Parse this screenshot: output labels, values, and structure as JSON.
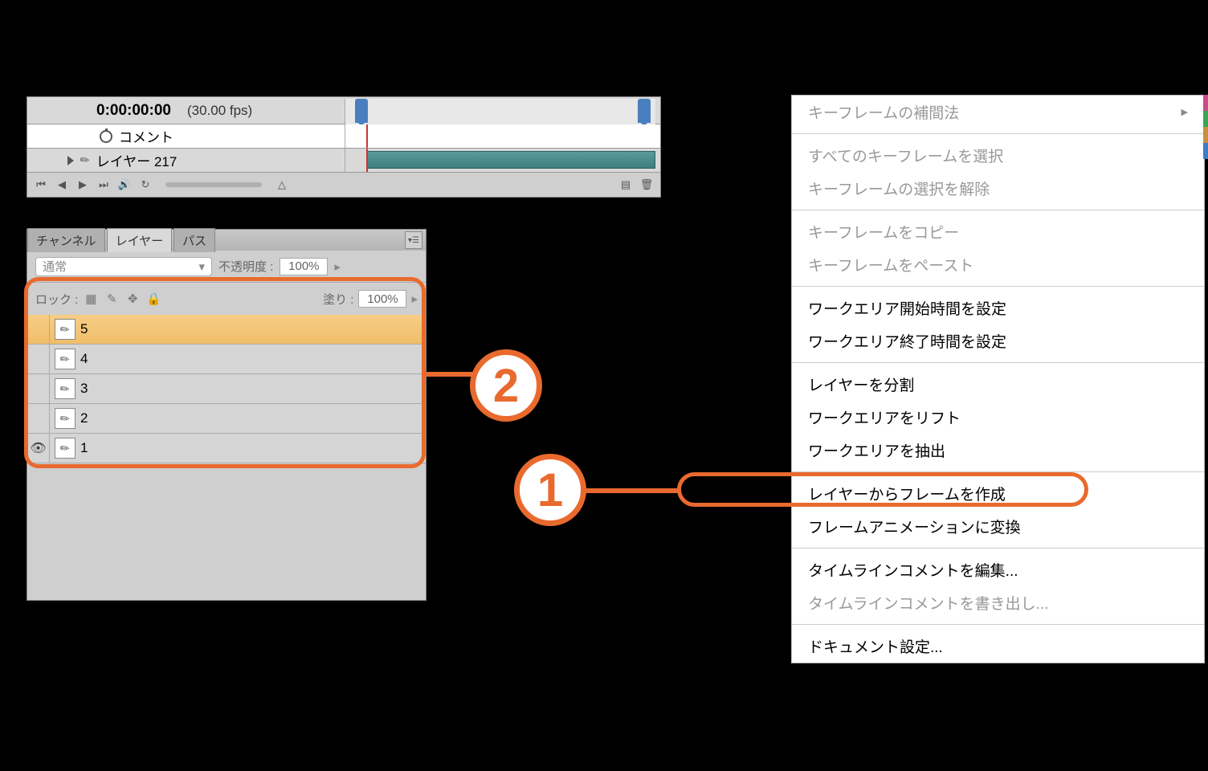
{
  "timeline": {
    "time": "0:00:00:00",
    "fps": "(30.00 fps)",
    "comment_label": "コメント",
    "layer_label": "レイヤー 217"
  },
  "layers_panel": {
    "tabs": [
      "チャンネル",
      "レイヤー",
      "パス"
    ],
    "blend_mode": "通常",
    "opacity_label": "不透明度 :",
    "opacity_value": "100%",
    "lock_label": "ロック :",
    "fill_label": "塗り :",
    "fill_value": "100%",
    "items": [
      {
        "name": "5",
        "visible": false,
        "selected": true
      },
      {
        "name": "4",
        "visible": false,
        "selected": false
      },
      {
        "name": "3",
        "visible": false,
        "selected": false
      },
      {
        "name": "2",
        "visible": false,
        "selected": false
      },
      {
        "name": "1",
        "visible": true,
        "selected": false
      }
    ]
  },
  "context_menu": {
    "items": [
      {
        "label": "キーフレームの補間法",
        "type": "submenu",
        "disabled": true
      },
      {
        "type": "sep"
      },
      {
        "label": "すべてのキーフレームを選択",
        "disabled": true
      },
      {
        "label": "キーフレームの選択を解除",
        "disabled": true
      },
      {
        "type": "sep"
      },
      {
        "label": "キーフレームをコピー",
        "disabled": true
      },
      {
        "label": "キーフレームをペースト",
        "disabled": true
      },
      {
        "type": "sep"
      },
      {
        "label": "ワークエリア開始時間を設定"
      },
      {
        "label": "ワークエリア終了時間を設定"
      },
      {
        "type": "sep"
      },
      {
        "label": "レイヤーを分割"
      },
      {
        "label": "ワークエリアをリフト"
      },
      {
        "label": "ワークエリアを抽出"
      },
      {
        "type": "sep"
      },
      {
        "label": "レイヤーからフレームを作成"
      },
      {
        "label": "フレームアニメーションに変換"
      },
      {
        "type": "sep"
      },
      {
        "label": "タイムラインコメントを編集..."
      },
      {
        "label": "タイムラインコメントを書き出し...",
        "disabled": true
      },
      {
        "type": "sep"
      },
      {
        "label": "ドキュメント設定..."
      }
    ]
  },
  "badges": {
    "one": "1",
    "two": "2"
  },
  "colors": {
    "accent": "#e96a2e"
  }
}
